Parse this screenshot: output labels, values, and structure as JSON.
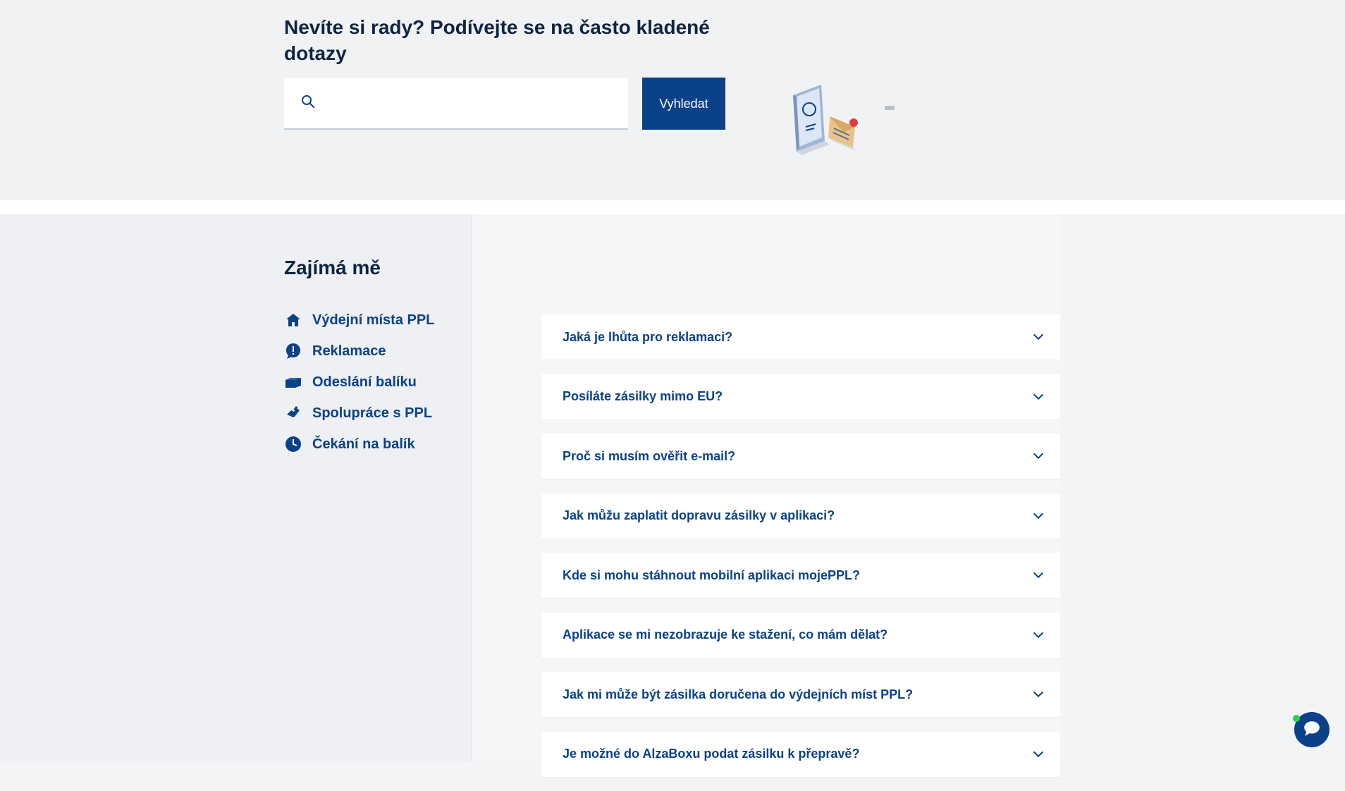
{
  "hero": {
    "title": "Nevíte si rady? Podívejte se na často kladené dotazy",
    "search_placeholder": "",
    "search_button": "Vyhledat"
  },
  "sidebar": {
    "title": "Zajímá mě",
    "items": [
      {
        "label": "Výdejní místa PPL",
        "icon": "home-icon"
      },
      {
        "label": "Reklamace",
        "icon": "exclamation-icon"
      },
      {
        "label": "Odeslání balíku",
        "icon": "package-icon"
      },
      {
        "label": "Spolupráce s PPL",
        "icon": "handshake-icon"
      },
      {
        "label": "Čekání na balík",
        "icon": "clock-icon"
      }
    ]
  },
  "faq": {
    "items": [
      {
        "question": "Jaká je lhůta pro reklamaci?"
      },
      {
        "question": "Posíláte zásilky mimo EU?"
      },
      {
        "question": "Proč si musím ověřit e-mail?"
      },
      {
        "question": "Jak můžu zaplatit dopravu zásilky v aplikaci?"
      },
      {
        "question": "Kde si mohu stáhnout mobilní aplikaci mojePPL?"
      },
      {
        "question": "Aplikace se mi nezobrazuje ke stažení, co mám dělat?"
      },
      {
        "question": "Jak mi může být zásilka doručena do výdejních míst PPL?"
      },
      {
        "question": "Je možné do AlzaBoxu podat zásilku k přepravě?"
      }
    ]
  },
  "colors": {
    "brand": "#0b4189",
    "heading": "#0e2542",
    "online": "#2ad44a"
  }
}
